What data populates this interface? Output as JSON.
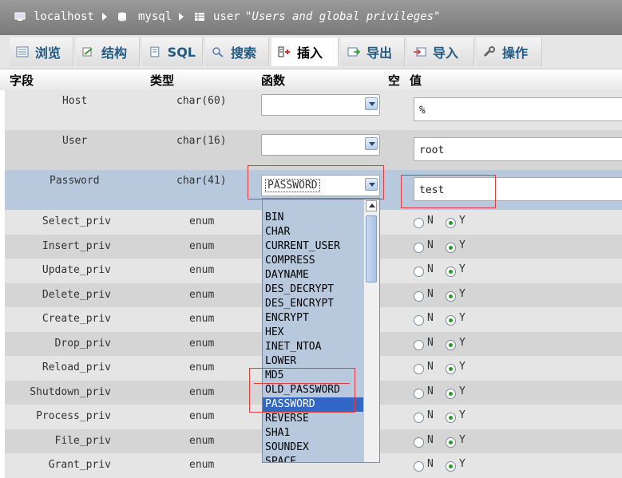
{
  "breadcrumb": {
    "server": "localhost",
    "database": "mysql",
    "table": "user",
    "comment": "\"Users and global privileges\""
  },
  "tabs": [
    {
      "label": "浏览",
      "icon": "browse-icon"
    },
    {
      "label": "结构",
      "icon": "structure-icon"
    },
    {
      "label": "SQL",
      "icon": "sql-icon"
    },
    {
      "label": "搜索",
      "icon": "search-icon"
    },
    {
      "label": "插入",
      "icon": "insert-icon",
      "active": true
    },
    {
      "label": "导出",
      "icon": "export-icon"
    },
    {
      "label": "导入",
      "icon": "import-icon"
    },
    {
      "label": "操作",
      "icon": "wrench-icon"
    }
  ],
  "columns": {
    "field": "字段",
    "type": "类型",
    "function": "函数",
    "null": "空",
    "value": "值"
  },
  "text_rows": [
    {
      "field": "Host",
      "type": "char(60)",
      "function": "",
      "value": "%"
    },
    {
      "field": "User",
      "type": "char(16)",
      "function": "",
      "value": "root"
    },
    {
      "field": "Password",
      "type": "char(41)",
      "function": "PASSWORD",
      "value": "test"
    }
  ],
  "enum_rows": [
    {
      "field": "Select_priv",
      "type": "enum",
      "n_label": "N",
      "y_label": "Y",
      "selected": "Y"
    },
    {
      "field": "Insert_priv",
      "type": "enum",
      "n_label": "N",
      "y_label": "Y",
      "selected": "Y"
    },
    {
      "field": "Update_priv",
      "type": "enum",
      "n_label": "N",
      "y_label": "Y",
      "selected": "Y"
    },
    {
      "field": "Delete_priv",
      "type": "enum",
      "n_label": "N",
      "y_label": "Y",
      "selected": "Y"
    },
    {
      "field": "Create_priv",
      "type": "enum",
      "n_label": "N",
      "y_label": "Y",
      "selected": "Y"
    },
    {
      "field": "Drop_priv",
      "type": "enum",
      "n_label": "N",
      "y_label": "Y",
      "selected": "Y"
    },
    {
      "field": "Reload_priv",
      "type": "enum",
      "n_label": "N",
      "y_label": "Y",
      "selected": "Y"
    },
    {
      "field": "Shutdown_priv",
      "type": "enum",
      "n_label": "N",
      "y_label": "Y",
      "selected": "Y"
    },
    {
      "field": "Process_priv",
      "type": "enum",
      "n_label": "N",
      "y_label": "Y",
      "selected": "Y"
    },
    {
      "field": "File_priv",
      "type": "enum",
      "n_label": "N",
      "y_label": "Y",
      "selected": "Y"
    },
    {
      "field": "Grant_priv",
      "type": "enum",
      "n_label": "N",
      "y_label": "Y",
      "selected": "Y"
    }
  ],
  "function_dropdown": {
    "options": [
      "BIN",
      "CHAR",
      "CURRENT_USER",
      "COMPRESS",
      "DAYNAME",
      "DES_DECRYPT",
      "DES_ENCRYPT",
      "ENCRYPT",
      "HEX",
      "INET_NTOA",
      "LOWER",
      "MD5",
      "OLD_PASSWORD",
      "PASSWORD",
      "REVERSE",
      "SHA1",
      "SOUNDEX",
      "SPACE"
    ],
    "highlighted": "PASSWORD"
  },
  "colors": {
    "row_odd": "#e5e5e5",
    "row_even": "#d5d5d5",
    "row_selected": "#b8c9dd",
    "highlight": "#3168c5",
    "annotation": "#e23b3b"
  }
}
